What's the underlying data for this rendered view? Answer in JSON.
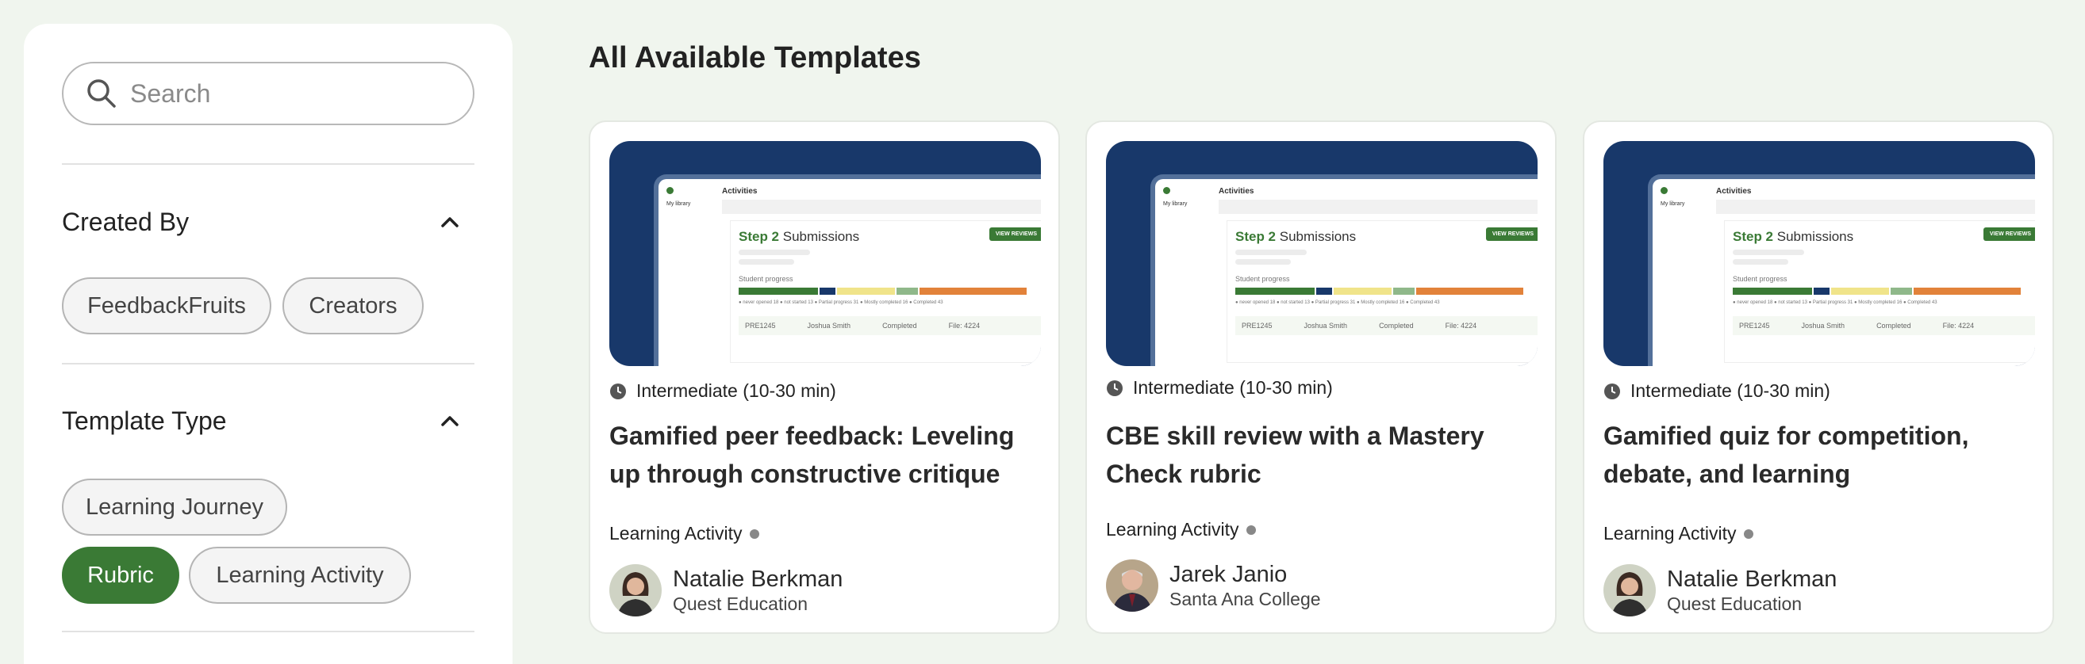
{
  "sidebar": {
    "search_placeholder": "Search",
    "created_by": {
      "title": "Created By",
      "chips": [
        "FeedbackFruits",
        "Creators"
      ]
    },
    "template_type": {
      "title": "Template Type",
      "chips": [
        "Learning Journey",
        "Rubric",
        "Learning Activity"
      ],
      "active": "Rubric"
    }
  },
  "main": {
    "heading": "All Available Templates",
    "cards": [
      {
        "level": "Intermediate (10-30 min)",
        "title": "Gamified peer feedback: Leveling up through constructive critique",
        "type": "Learning Activity",
        "author": "Natalie Berkman",
        "org": "Quest Education",
        "avatar": "woman-avatar"
      },
      {
        "level": "Intermediate (10-30 min)",
        "title": "CBE skill review with a Mastery Check rubric",
        "type": "Learning Activity",
        "author": "Jarek Janio",
        "org": "Santa Ana College",
        "avatar": "man-avatar"
      },
      {
        "level": "Intermediate (10-30 min)",
        "title": "Gamified quiz for competition, debate, and learning",
        "type": "Learning Activity",
        "author": "Natalie Berkman",
        "org": "Quest Education",
        "avatar": "woman-avatar"
      }
    ],
    "thumbnail": {
      "app_section": "Activities",
      "library": "My library",
      "step_prefix": "Step 2",
      "step_text": "Submissions",
      "view_button": "VIEW REVIEWS",
      "progress_label": "Student progress",
      "legend": "● never opened 18   ● not started 13   ● Partial progress 31   ● Mostly completed 16   ● Completed 43",
      "row_id": "PRE1245",
      "row_name": "Joshua Smith",
      "row_status": "Completed",
      "row_file": "File: 4224"
    }
  },
  "colors": {
    "accent_green": "#3a7a35",
    "thumb_navy": "#18386a",
    "page_bg": "#f0f5ee"
  }
}
